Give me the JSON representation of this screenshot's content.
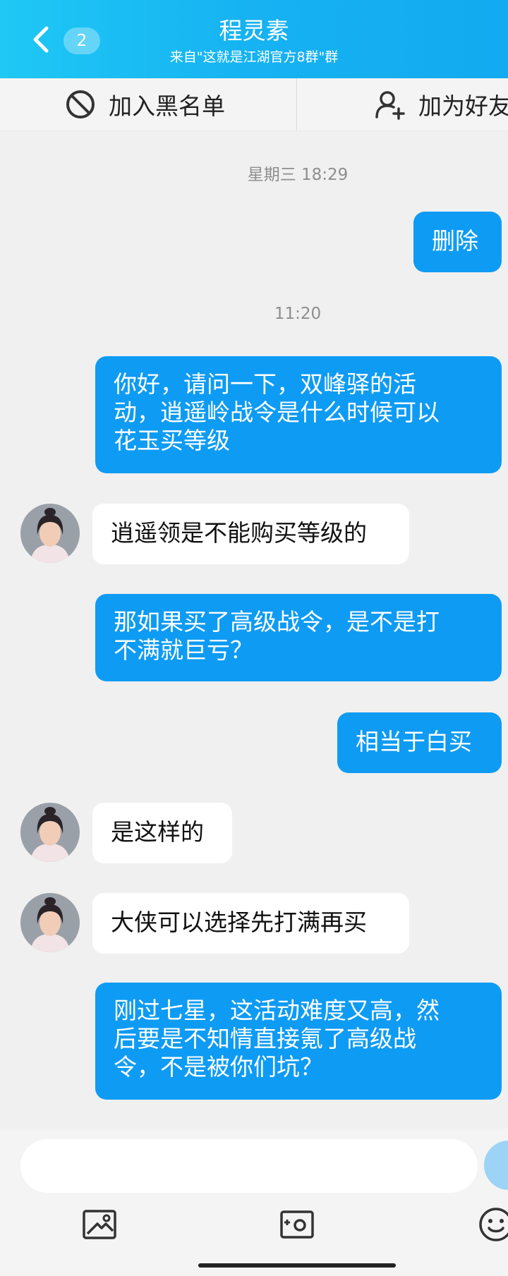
{
  "header": {
    "badge_count": "2",
    "title": "程灵素",
    "subtitle": "来自\"这就是江湖官方8群\"群"
  },
  "actions": {
    "blacklist": "加入黑名单",
    "add_friend": "加为好友"
  },
  "messages": [
    {
      "type": "timestamp",
      "text": "星期三 18:29"
    },
    {
      "type": "sent",
      "text": "删除"
    },
    {
      "type": "timestamp",
      "text": "11:20"
    },
    {
      "type": "sent",
      "text": "你好，请问一下，双峰驿的活\n动，逍遥岭战令是什么时候可以\n花玉买等级"
    },
    {
      "type": "received",
      "text": "逍遥领是不能购买等级的"
    },
    {
      "type": "sent",
      "text": "那如果买了高级战令，是不是打\n不满就巨亏？"
    },
    {
      "type": "sent",
      "text": "相当于白买"
    },
    {
      "type": "received",
      "text": "是这样的"
    },
    {
      "type": "received",
      "text": "大侠可以选择先打满再买"
    },
    {
      "type": "sent",
      "text": "刚过七星，这活动难度又高，然\n后要是不知情直接氪了高级战\n令，不是被你们坑？"
    }
  ],
  "composer": {
    "input_value": "",
    "tools": [
      "image-icon",
      "camera-icon",
      "emoji-icon"
    ]
  },
  "colors": {
    "header": "#16b2f2",
    "sent_bubble": "#0e9bf4",
    "received_bubble": "#ffffff",
    "background": "#f0f0f0"
  }
}
